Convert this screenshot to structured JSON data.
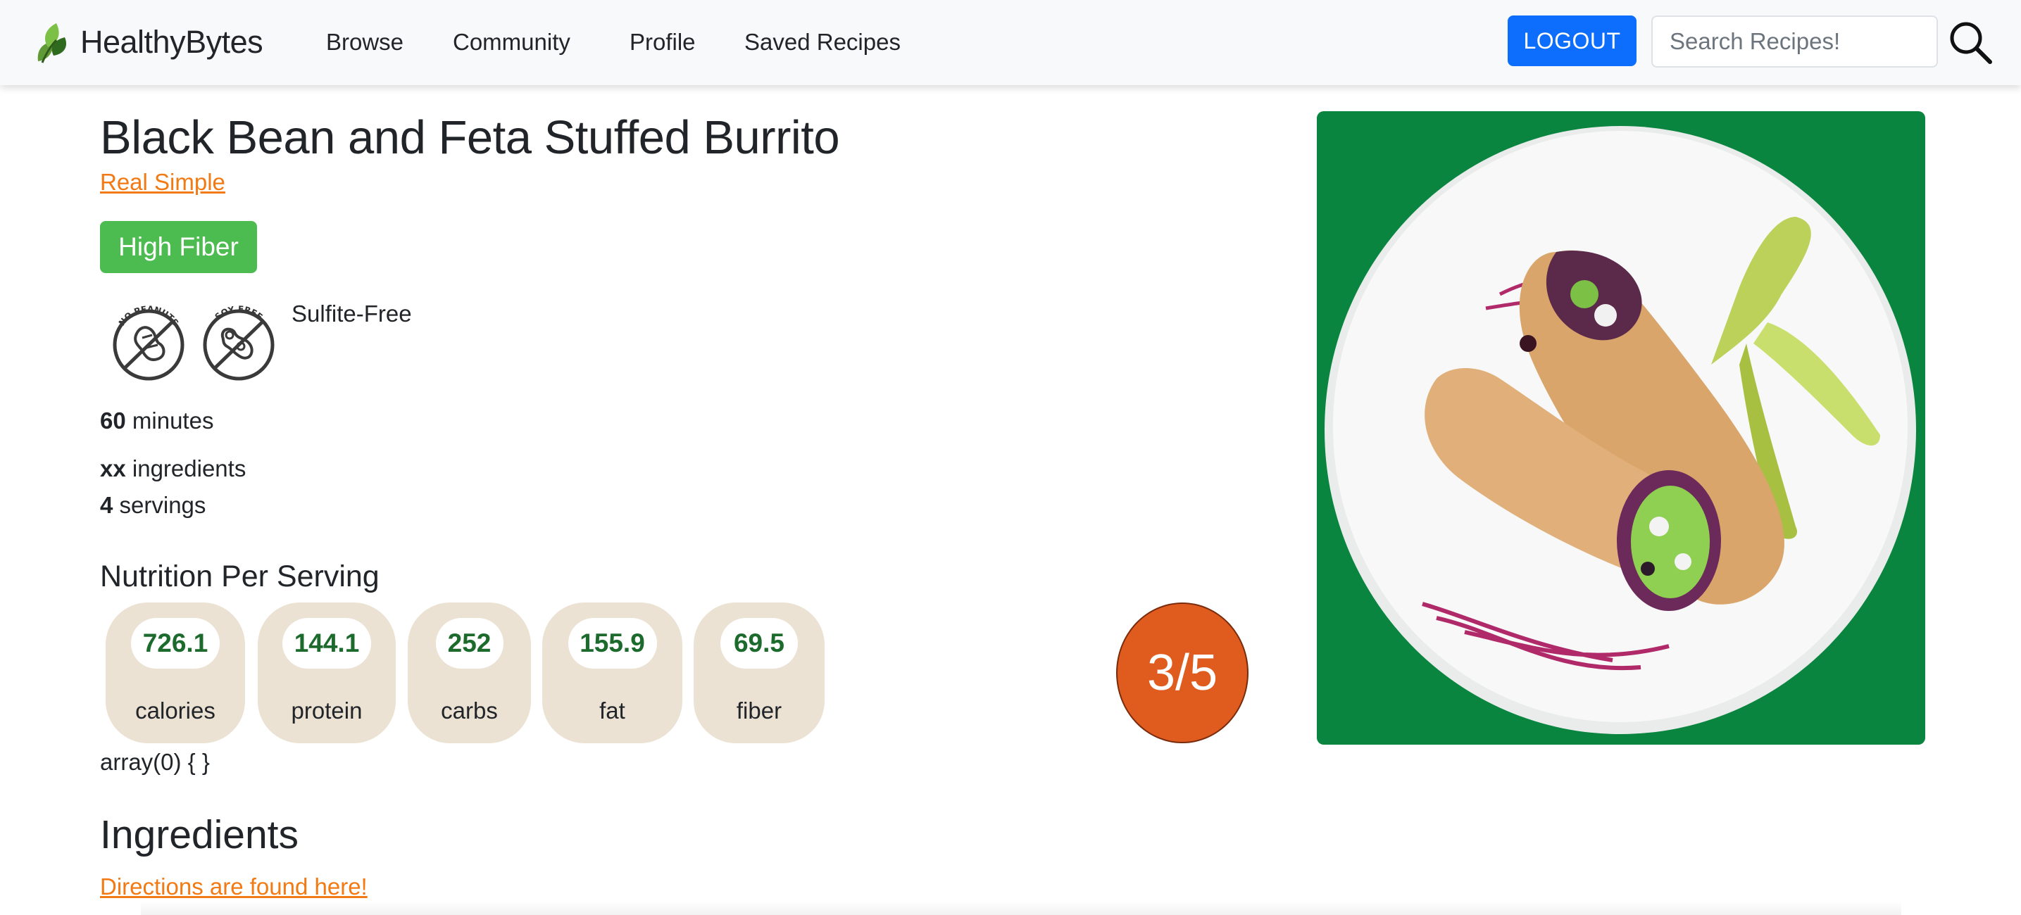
{
  "navbar": {
    "brand": "HealthyBytes",
    "links": [
      "Browse",
      "Community",
      "Profile",
      "Saved Recipes"
    ],
    "logout_label": "LOGOUT",
    "search_placeholder": "Search Recipes!"
  },
  "recipe": {
    "title": "Black Bean and Feta Stuffed Burrito",
    "source": "Real Simple",
    "tag": "High Fiber",
    "diet_icons": [
      "NO PEANUTS",
      "SOY FREE"
    ],
    "diet_text": "Sulfite-Free",
    "time_value": "60",
    "time_unit": "minutes",
    "ingredients_value": "xx",
    "ingredients_unit": "ingredients",
    "servings_value": "4",
    "servings_unit": "servings"
  },
  "nutrition": {
    "heading": "Nutrition Per Serving",
    "items": [
      {
        "value": "726.1",
        "label": "calories"
      },
      {
        "value": "144.1",
        "label": "protein"
      },
      {
        "value": "252",
        "label": "carbs"
      },
      {
        "value": "155.9",
        "label": "fat"
      },
      {
        "value": "69.5",
        "label": "fiber"
      }
    ],
    "debug_text": "array(0) { }"
  },
  "rating": {
    "text": "3/5"
  },
  "ingredients": {
    "heading": "Ingredients",
    "directions_link": "Directions are found here!"
  },
  "colors": {
    "brand_orange": "#f27a14",
    "badge_green": "#4cbb50",
    "logout_blue": "#0d6efd",
    "rating_orange": "#e05c1e",
    "nutrition_value_green": "#1c6b2d",
    "pill_beige": "#ece2d3",
    "image_background_green": "#0b8a44"
  }
}
